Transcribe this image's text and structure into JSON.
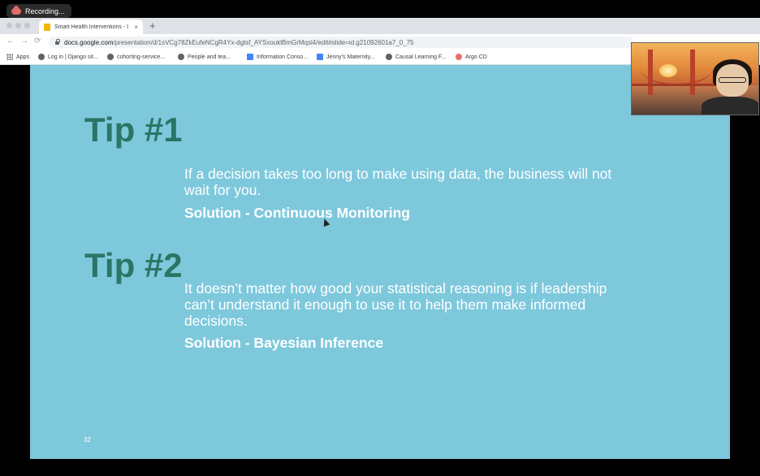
{
  "recording": {
    "label": "Recording..."
  },
  "browser": {
    "tab": {
      "title": "Smart Health Interventions - I",
      "close": "×"
    },
    "new_tab": "+",
    "nav": {
      "back": "←",
      "forward": "→",
      "reload": "⟳"
    },
    "url": {
      "host": "docs.google.com",
      "path": "/presentation/d/1sVCg78ZkEufeNCgR4Yx-dgtsf_AYSxouklBmGrMqsl4/edit#slide=id.g21092601a7_0_75"
    },
    "bookmarks": [
      {
        "label": "Apps",
        "icon": "apps-grid-icon"
      },
      {
        "label": "Log in | Django sit...",
        "icon": "globe-icon"
      },
      {
        "label": "cohorting-service...",
        "icon": "globe-icon"
      },
      {
        "label": "People and tea...",
        "icon": "people-icon"
      },
      {
        "label": "Information Conso...",
        "icon": "doc-icon"
      },
      {
        "label": "Jenny's Maternity...",
        "icon": "doc-icon"
      },
      {
        "label": "Causal Learning F...",
        "icon": "globe-icon"
      },
      {
        "label": "Argo CD",
        "icon": "argo-icon"
      }
    ]
  },
  "slide": {
    "tip1": {
      "heading": "Tip #1",
      "body": "If a decision takes too long to make using data, the business will not wait for you.",
      "solution": "Solution - Continuous Monitoring"
    },
    "tip2": {
      "heading": "Tip #2",
      "body": "It doesn’t matter how good your statistical reasoning is if leadership can’t understand it enough to use it to help them make informed decisions.",
      "solution": "Solution - Bayesian Inference"
    },
    "page_number": "32",
    "colors": {
      "background": "#7ec8dc",
      "heading": "#2c7566",
      "text": "#ffffff"
    }
  }
}
